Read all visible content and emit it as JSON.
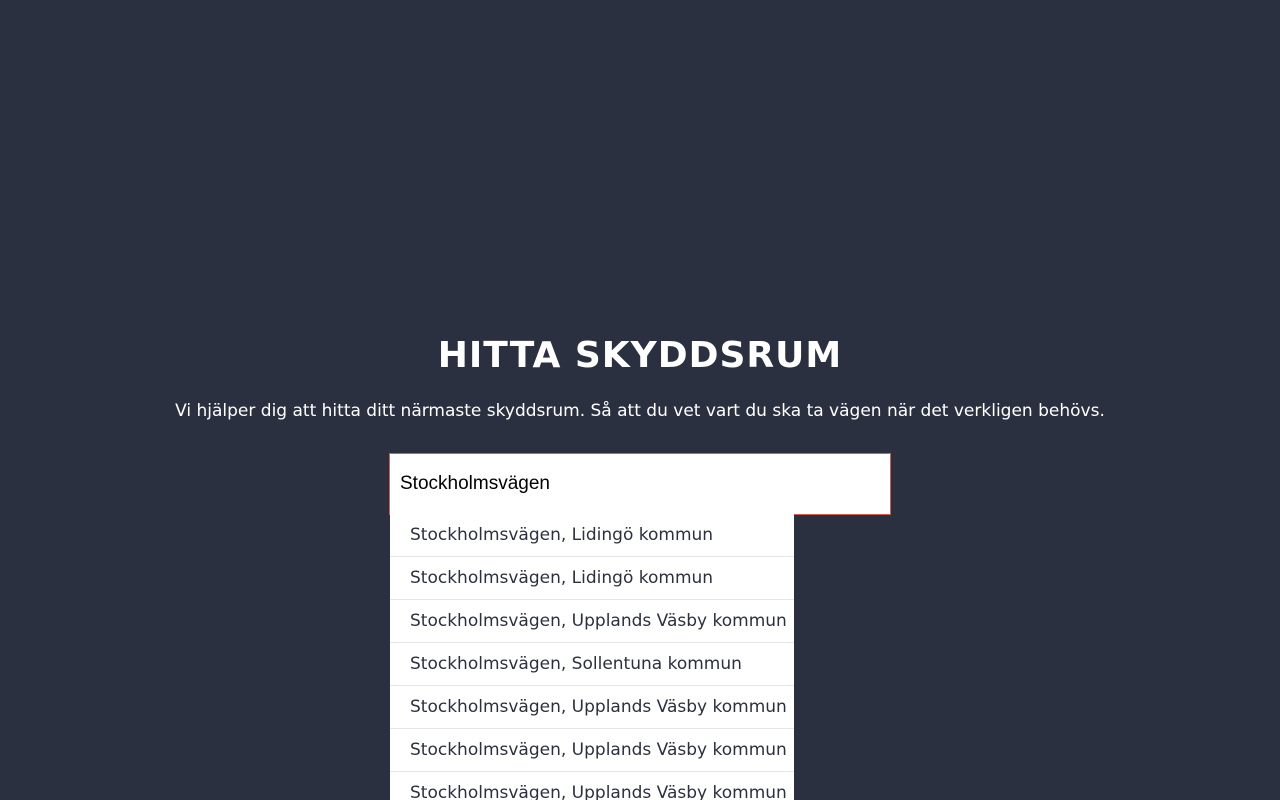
{
  "header": {
    "title": "HITTA SKYDDSRUM",
    "subtitle": "Vi hjälper dig att hitta ditt närmaste skyddsrum. Så att du vet vart du ska ta vägen när det verkligen behövs."
  },
  "search": {
    "value": "Stockholmsvägen"
  },
  "suggestions": [
    {
      "label": "Stockholmsvägen, Lidingö kommun"
    },
    {
      "label": "Stockholmsvägen, Lidingö kommun"
    },
    {
      "label": "Stockholmsvägen, Upplands Väsby kommun"
    },
    {
      "label": "Stockholmsvägen, Sollentuna kommun"
    },
    {
      "label": "Stockholmsvägen, Upplands Väsby kommun"
    },
    {
      "label": "Stockholmsvägen, Upplands Väsby kommun"
    },
    {
      "label": "Stockholmsvägen, Upplands Väsby kommun"
    }
  ],
  "colors": {
    "background": "#2b3040",
    "input_border": "#d35f4b",
    "suggestion_text": "#2b3040"
  }
}
